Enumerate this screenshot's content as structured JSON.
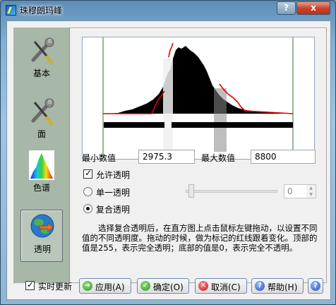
{
  "window": {
    "title": "珠穆朗玛峰",
    "help_button": "?",
    "close_button": "x"
  },
  "nav": {
    "items": [
      {
        "label": "基本",
        "icon": "wrench-screwdriver-icon",
        "active": false
      },
      {
        "label": "面",
        "icon": "wrench-screwdriver-icon",
        "active": false
      },
      {
        "label": "色谱",
        "icon": "color-spectrum-icon",
        "active": false
      },
      {
        "label": "透明",
        "icon": "globe-arrow-icon",
        "active": true
      }
    ]
  },
  "range": {
    "min_label": "最小数值",
    "min_value": "2975.3",
    "max_label": "最大数值",
    "max_value": "8800"
  },
  "options": {
    "allow_transparency": {
      "label": "允许透明",
      "checked": true
    },
    "single": {
      "label": "单一透明",
      "selected": false
    },
    "composite": {
      "label": "复合透明",
      "selected": true
    },
    "spin_value": "0"
  },
  "description": "选择复合透明后，在直方图上点击鼠标左键拖动，以设置不同值的不同透明度。拖动的时候，做为标记的红线跟着变化。顶部的值是255，表示完全透明；底部的值是0，表示完全不透明。",
  "footer": {
    "realtime": {
      "label": "实时更新",
      "checked": true
    },
    "apply": "应用(A)",
    "ok": "确定(O)",
    "cancel": "取消(C)",
    "help": "帮助(H)"
  },
  "colors": {
    "accent_red": "#e00000",
    "histogram": "#000000",
    "nav_bg": "#a7b7a8"
  }
}
